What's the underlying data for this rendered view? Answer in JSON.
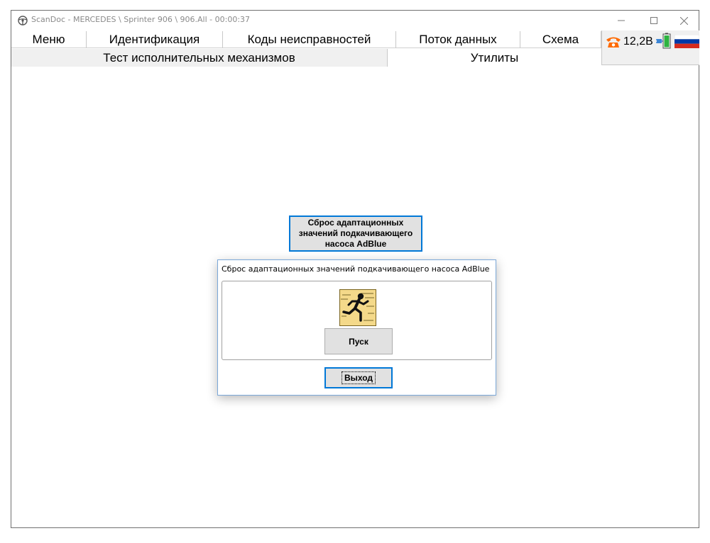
{
  "window": {
    "title": "ScanDoc - MERCEDES \\ Sprinter 906 \\ 906.All - 00:00:37",
    "controls": {
      "minimize": "minimize-icon",
      "maximize": "maximize-icon",
      "close": "close-icon"
    }
  },
  "tabs_row1": [
    {
      "label": "Меню"
    },
    {
      "label": "Идентификация"
    },
    {
      "label": "Коды неисправностей"
    },
    {
      "label": "Поток данных"
    },
    {
      "label": "Схема"
    }
  ],
  "tabs_row2": [
    {
      "label": "Тест исполнительных механизмов",
      "active": false
    },
    {
      "label": "Утилиты",
      "active": true
    }
  ],
  "status": {
    "voltage": "12,2В",
    "icons": [
      "phone-icon",
      "plug-battery-icon",
      "russian-flag-icon"
    ],
    "accent_color": "#ff6a00"
  },
  "function_button": {
    "label": "Сброс адаптационных значений подкачивающего насоса AdBlue"
  },
  "dialog": {
    "title": "Сброс адаптационных значений подкачивающего насоса AdBlue",
    "icon": "running-man-icon",
    "start_label": "Пуск",
    "exit_label": "Выход"
  },
  "colors": {
    "focus_border": "#0078d7",
    "button_bg": "#e1e1e1",
    "tab_inactive_bg": "#f0f0f0"
  }
}
